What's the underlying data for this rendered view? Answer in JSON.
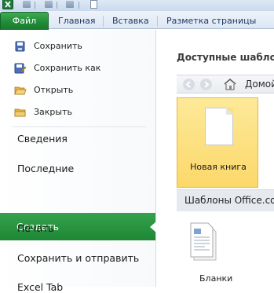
{
  "ribbon": {
    "file_tab": "Файл",
    "tabs": [
      "Главная",
      "Вставка",
      "Разметка страницы"
    ]
  },
  "nav": {
    "commands": [
      {
        "label": "Сохранить",
        "icon": "save-icon"
      },
      {
        "label": "Сохранить как",
        "icon": "save-as-icon"
      },
      {
        "label": "Открыть",
        "icon": "open-folder-icon"
      },
      {
        "label": "Закрыть",
        "icon": "close-folder-icon"
      }
    ],
    "sections": [
      "Сведения",
      "Последние",
      "Создать",
      "Печать",
      "Сохранить и отправить",
      "Excel Tab"
    ],
    "active": "Создать"
  },
  "pane": {
    "title": "Доступные шаблоны",
    "breadcrumb": "Домой",
    "new_workbook": "Новая книга",
    "office_templates": "Шаблоны Office.com",
    "forms": "Бланки"
  },
  "colors": {
    "accent_green": "#1f8a36",
    "tile_yellow": "#fbd86a"
  }
}
